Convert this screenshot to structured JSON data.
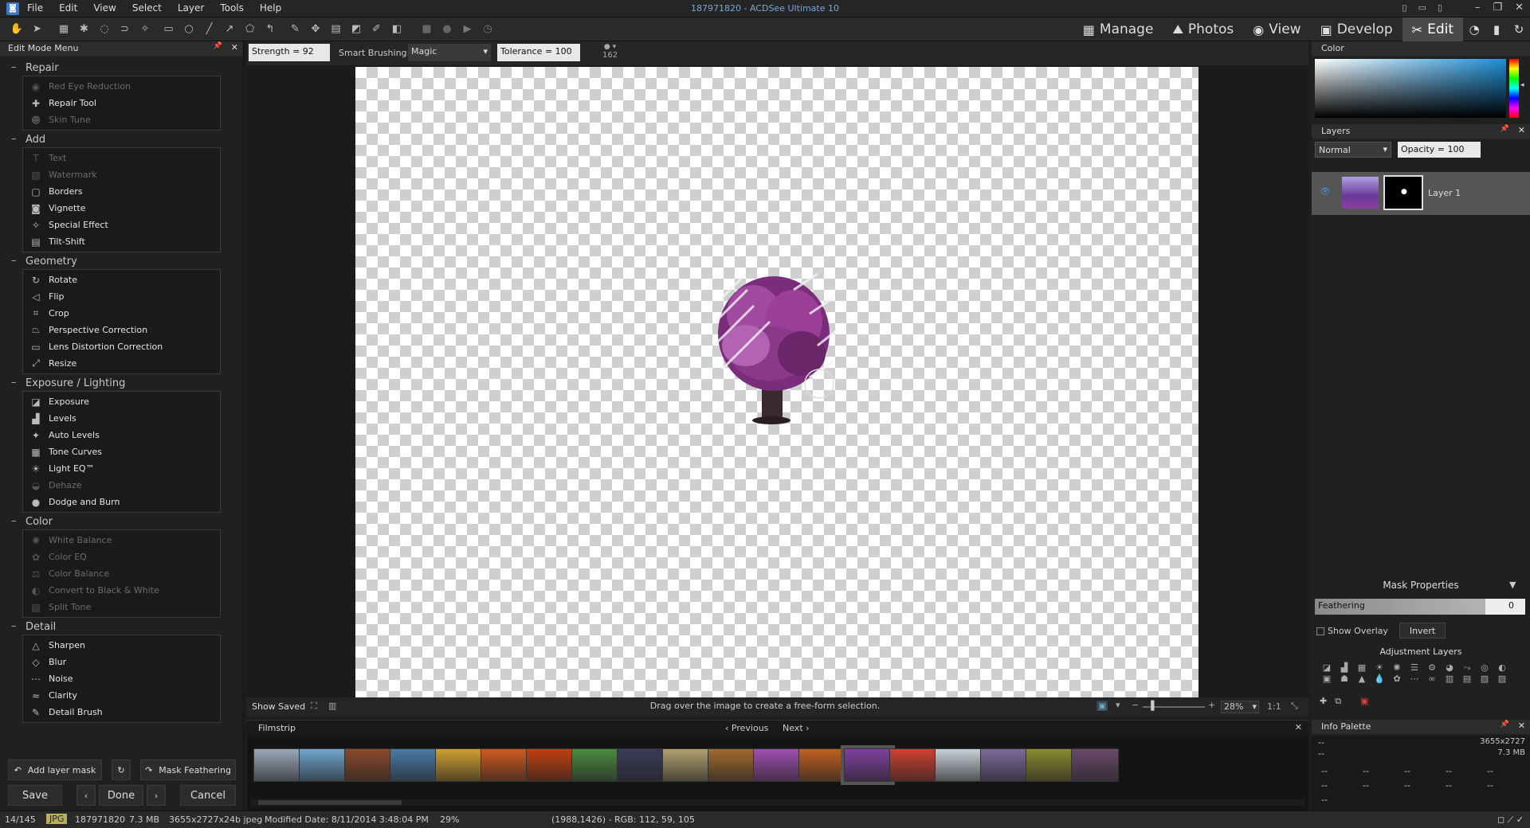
{
  "window": {
    "title": "187971820 - ACDSee Ultimate 10"
  },
  "menu": [
    "File",
    "Edit",
    "View",
    "Select",
    "Layer",
    "Tools",
    "Help"
  ],
  "modes": [
    {
      "label": "Manage",
      "icon": "grid-icon"
    },
    {
      "label": "Photos",
      "icon": "photos-icon"
    },
    {
      "label": "View",
      "icon": "eye-icon"
    },
    {
      "label": "Develop",
      "icon": "develop-icon"
    },
    {
      "label": "Edit",
      "icon": "edit-icon",
      "active": true
    }
  ],
  "left_panel": {
    "title": "Edit Mode Menu",
    "groups": [
      {
        "name": "Repair",
        "items": [
          {
            "label": "Red Eye Reduction",
            "icon": "eye-icon",
            "enabled": false
          },
          {
            "label": "Repair Tool",
            "icon": "bandage-icon",
            "enabled": true
          },
          {
            "label": "Skin Tune",
            "icon": "person-icon",
            "enabled": false
          }
        ]
      },
      {
        "name": "Add",
        "items": [
          {
            "label": "Text",
            "icon": "text-icon",
            "enabled": false
          },
          {
            "label": "Watermark",
            "icon": "watermark-icon",
            "enabled": false
          },
          {
            "label": "Borders",
            "icon": "borders-icon",
            "enabled": true
          },
          {
            "label": "Vignette",
            "icon": "vignette-icon",
            "enabled": true
          },
          {
            "label": "Special Effect",
            "icon": "sparkle-icon",
            "enabled": true
          },
          {
            "label": "Tilt-Shift",
            "icon": "tiltshift-icon",
            "enabled": true
          }
        ]
      },
      {
        "name": "Geometry",
        "items": [
          {
            "label": "Rotate",
            "icon": "rotate-icon",
            "enabled": true
          },
          {
            "label": "Flip",
            "icon": "flip-icon",
            "enabled": true
          },
          {
            "label": "Crop",
            "icon": "crop-icon",
            "enabled": true
          },
          {
            "label": "Perspective Correction",
            "icon": "perspective-icon",
            "enabled": true
          },
          {
            "label": "Lens Distortion Correction",
            "icon": "lens-icon",
            "enabled": true
          },
          {
            "label": "Resize",
            "icon": "resize-icon",
            "enabled": true
          }
        ]
      },
      {
        "name": "Exposure / Lighting",
        "items": [
          {
            "label": "Exposure",
            "icon": "exposure-icon",
            "enabled": true
          },
          {
            "label": "Levels",
            "icon": "levels-icon",
            "enabled": true
          },
          {
            "label": "Auto Levels",
            "icon": "autolevels-icon",
            "enabled": true
          },
          {
            "label": "Tone Curves",
            "icon": "curves-icon",
            "enabled": true
          },
          {
            "label": "Light EQ™",
            "icon": "lighteq-icon",
            "enabled": true
          },
          {
            "label": "Dehaze",
            "icon": "dehaze-icon",
            "enabled": false
          },
          {
            "label": "Dodge and Burn",
            "icon": "dodge-icon",
            "enabled": true
          }
        ]
      },
      {
        "name": "Color",
        "items": [
          {
            "label": "White Balance",
            "icon": "whitebalance-icon",
            "enabled": false
          },
          {
            "label": "Color EQ",
            "icon": "coloreq-icon",
            "enabled": false
          },
          {
            "label": "Color Balance",
            "icon": "colorbalance-icon",
            "enabled": false
          },
          {
            "label": "Convert to Black & White",
            "icon": "bw-icon",
            "enabled": false
          },
          {
            "label": "Split Tone",
            "icon": "splittone-icon",
            "enabled": false
          }
        ]
      },
      {
        "name": "Detail",
        "items": [
          {
            "label": "Sharpen",
            "icon": "sharpen-icon",
            "enabled": true
          },
          {
            "label": "Blur",
            "icon": "blur-icon",
            "enabled": true
          },
          {
            "label": "Noise",
            "icon": "noise-icon",
            "enabled": true
          },
          {
            "label": "Clarity",
            "icon": "clarity-icon",
            "enabled": true
          },
          {
            "label": "Detail Brush",
            "icon": "brush-icon",
            "enabled": true
          }
        ]
      }
    ],
    "add_layer_mask": "Add layer mask",
    "mask_feathering": "Mask Feathering",
    "save": "Save",
    "done": "Done",
    "cancel": "Cancel"
  },
  "options_bar": {
    "strength": "Strength = 92",
    "smart_brushing_label": "Smart Brushing:",
    "smart_brushing_value": "Magic",
    "tolerance": "Tolerance = 100",
    "brush_size": "162"
  },
  "canvas": {
    "show_saved": "Show Saved",
    "hint": "Drag over the image to create a free-form selection.",
    "zoom": "28%",
    "ratio": "1:1"
  },
  "filmstrip": {
    "title": "Filmstrip",
    "previous": "Previous",
    "next": "Next",
    "thumbs": [
      "#9aa8b8",
      "#6fa6d0",
      "#8a4a2a",
      "#4a7aa8",
      "#d0a030",
      "#d05a20",
      "#c04010",
      "#4a8a40",
      "#3a3a5a",
      "#b0a070",
      "#a06a30",
      "#a050b0",
      "#c06020",
      "#8040a0",
      "#d04030",
      "#c8d0d8",
      "#7a6a9a",
      "#8a8a30",
      "#6a4a6a"
    ],
    "selected_index": 13
  },
  "color_panel": {
    "title": "Color"
  },
  "layers_panel": {
    "title": "Layers",
    "blend_mode": "Normal",
    "opacity": "Opacity = 100",
    "layer_name": "Layer 1",
    "mask_properties": "Mask Properties",
    "feathering_label": "Feathering",
    "feathering_value": "0",
    "show_overlay": "Show Overlay",
    "invert": "Invert",
    "adjustment_layers": "Adjustment Layers"
  },
  "info_palette": {
    "title": "Info Palette",
    "line1_left": "--",
    "line1_right": "3655x2727",
    "line2_left": "--",
    "line2_right": "7.3 MB",
    "cells": [
      "--",
      "--",
      "--",
      "--",
      "--",
      "--",
      "--",
      "--",
      "--",
      "--",
      "--"
    ]
  },
  "status_bar": {
    "index": "14/145",
    "format": "JPG",
    "filename": "187971820",
    "size": "7.3 MB",
    "dims": "3655x2727x24b jpeg",
    "modified": "Modified Date: 8/11/2014 3:48:04 PM",
    "zoom": "29%",
    "pixel": "(1988,1426) - RGB: 112, 59, 105"
  }
}
